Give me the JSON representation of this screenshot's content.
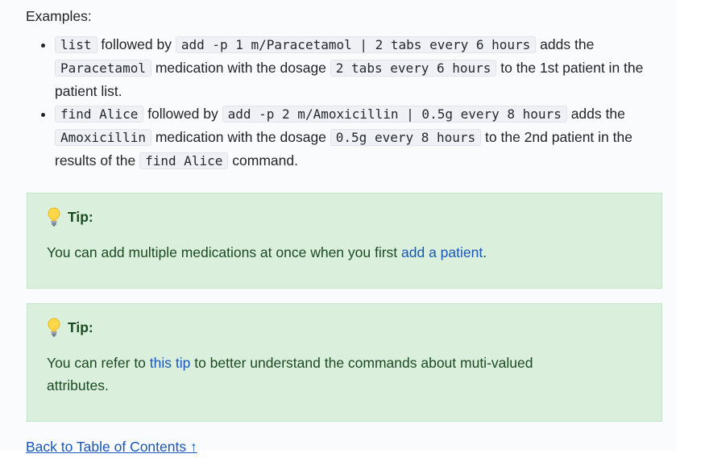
{
  "intro": "Examples:",
  "examples": [
    {
      "p1": "list",
      "p2": " followed by ",
      "p3": "add -p 1 m/Paracetamol | 2 tabs every 6 hours",
      "p4": " adds the ",
      "p5": "Paracetamol",
      "p6": " medication with the dosage ",
      "p7": "2 tabs every 6 hours",
      "p8": " to the 1st patient in the patient list."
    },
    {
      "p1": "find Alice",
      "p2": " followed by ",
      "p3": "add -p 2 m/Amoxicillin | 0.5g every 8 hours",
      "p4": " adds the ",
      "p5": "Amoxicillin",
      "p6": " medication with the dosage ",
      "p7": "0.5g every 8 hours",
      "p8": " to the 2nd patient in the results of the ",
      "p9": "find Alice",
      "p10": " command."
    }
  ],
  "tips": [
    {
      "title": "Tip:",
      "text_before": "You can add multiple medications at once when you first ",
      "link": "add a patient",
      "text_after": "."
    },
    {
      "title": "Tip:",
      "text_before": "You can refer to ",
      "link": "this tip",
      "text_after": " to better understand the commands about muti-valued attributes."
    }
  ],
  "back_link": "Back to Table of Contents ↑",
  "colors": {
    "tip_background": "#daefdc",
    "link": "#1a56b8",
    "code_background": "#f0f1f4"
  },
  "icons": [
    "lightbulb-icon"
  ]
}
